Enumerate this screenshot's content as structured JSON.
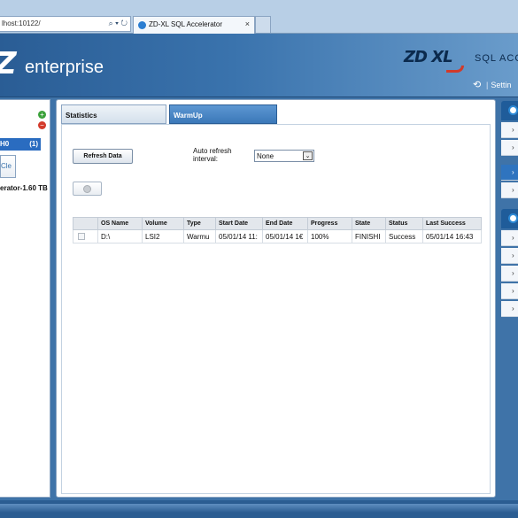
{
  "browser": {
    "address": "lhost:10122/",
    "address_icons": "⌕ ▾ ↻",
    "tab_title": "ZD-XL SQL Accelerator",
    "tab_close": "×"
  },
  "header": {
    "brand_mark": "Z",
    "brand_text": "enterprise",
    "logo_main": "ZD XL",
    "logo_sub": "SQL ACC",
    "settings_icon": "refresh-icon",
    "settings_label": "Settin"
  },
  "left_panel": {
    "add_icon": "+",
    "remove_icon": "−",
    "group_name": "H0",
    "group_count": "(1)",
    "clear_label": "Cle",
    "device_label": "erator-1.60 TB"
  },
  "tabs": [
    {
      "label": "Statistics"
    },
    {
      "label": "WarmUp"
    }
  ],
  "toolbar": {
    "refresh_label": "Refresh Data",
    "auto_refresh_label": "Auto refresh interval:",
    "interval_value": "None",
    "select_arrow": "⌄"
  },
  "table": {
    "headers": [
      "",
      "OS Name",
      "Volume",
      "Type",
      "Start Date",
      "End Date",
      "Progress",
      "State",
      "Status",
      "Last Success"
    ],
    "rows": [
      [
        "",
        "D:\\",
        "LSI2",
        "Warmu",
        "05/01/14 11:",
        "05/01/14 1€",
        "100%",
        "FINISHI",
        "Success",
        "05/01/14 16:43"
      ]
    ]
  },
  "right_panel": {
    "chevron": "›",
    "selected_index": 2
  }
}
